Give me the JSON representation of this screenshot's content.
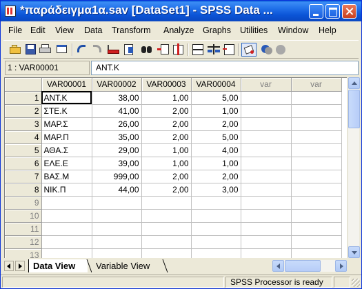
{
  "window": {
    "title": "*παράδειγμα1α.sav [DataSet1] - SPSS Data ...",
    "title_color": "#0a54d6"
  },
  "menu": [
    "File",
    "Edit",
    "View",
    "Data",
    "Transform",
    "Analyze",
    "Graphs",
    "Utilities",
    "Window",
    "Help"
  ],
  "toolbar": {
    "icons": [
      "open-icon",
      "save-icon",
      "print-icon",
      "dialog-recall-icon",
      "undo-icon",
      "redo-icon",
      "goto-case-icon",
      "variables-icon",
      "find-icon",
      "insert-cases-icon",
      "insert-variable-icon",
      "split-file-icon",
      "weight-cases-icon",
      "select-cases-icon",
      "value-labels-icon",
      "use-sets-icon",
      "show-all-icon"
    ]
  },
  "cell_editor": {
    "reference": "1 : VAR00001",
    "value": "ΑΝΤ.Κ"
  },
  "grid": {
    "columns": [
      "VAR00001",
      "VAR00002",
      "VAR00003",
      "VAR00004",
      "var",
      "var"
    ],
    "rows": [
      {
        "num": "1",
        "cells": [
          "ΑΝΤ.Κ",
          "38,00",
          "1,00",
          "5,00",
          "",
          ""
        ]
      },
      {
        "num": "2",
        "cells": [
          "ΣΤΕ.Κ",
          "41,00",
          "2,00",
          "1,00",
          "",
          ""
        ]
      },
      {
        "num": "3",
        "cells": [
          "ΜΑΡ.Σ",
          "26,00",
          "2,00",
          "2,00",
          "",
          ""
        ]
      },
      {
        "num": "4",
        "cells": [
          "ΜΑΡ.Π",
          "35,00",
          "2,00",
          "5,00",
          "",
          ""
        ]
      },
      {
        "num": "5",
        "cells": [
          "ΑΘΑ.Σ",
          "29,00",
          "1,00",
          "4,00",
          "",
          ""
        ]
      },
      {
        "num": "6",
        "cells": [
          "ΕΛΕ.Ε",
          "39,00",
          "1,00",
          "1,00",
          "",
          ""
        ]
      },
      {
        "num": "7",
        "cells": [
          "ΒΑΣ.Μ",
          "999,00",
          "2,00",
          "2,00",
          "",
          ""
        ]
      },
      {
        "num": "8",
        "cells": [
          "ΝΙΚ.Π",
          "44,00",
          "2,00",
          "3,00",
          "",
          ""
        ]
      },
      {
        "num": "9",
        "cells": [
          "",
          "",
          "",
          "",
          "",
          ""
        ]
      },
      {
        "num": "10",
        "cells": [
          "",
          "",
          "",
          "",
          "",
          ""
        ]
      },
      {
        "num": "11",
        "cells": [
          "",
          "",
          "",
          "",
          "",
          ""
        ]
      },
      {
        "num": "12",
        "cells": [
          "",
          "",
          "",
          "",
          "",
          ""
        ]
      },
      {
        "num": "13",
        "cells": [
          "",
          "",
          "",
          "",
          "",
          ""
        ]
      }
    ]
  },
  "tabs": {
    "active": "Data View",
    "inactive": "Variable View"
  },
  "status": {
    "processor": "SPSS Processor  is ready"
  }
}
